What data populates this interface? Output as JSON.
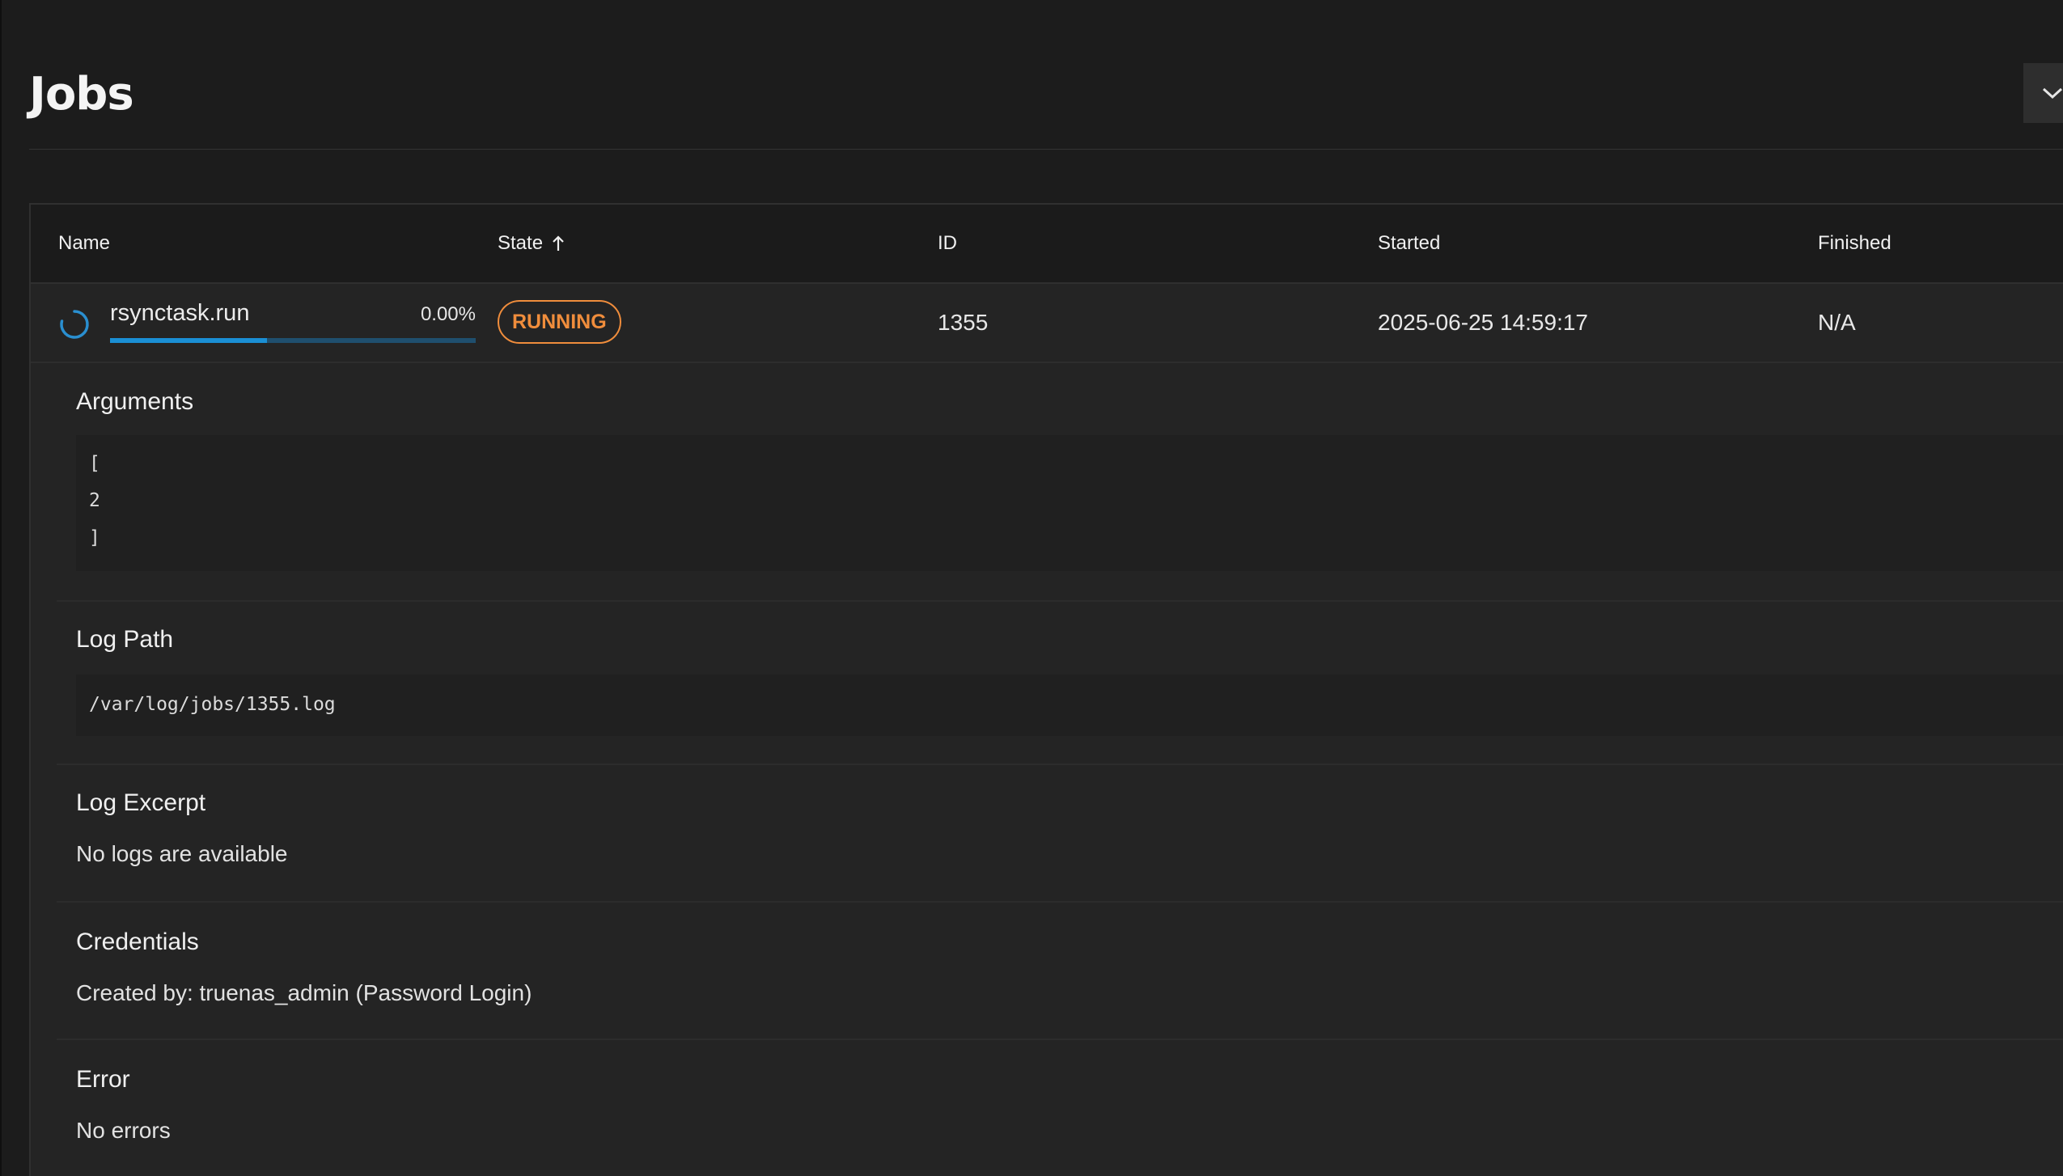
{
  "header": {
    "title": "Jobs",
    "toggle_icon": "chevron-down-icon"
  },
  "table": {
    "columns": [
      "Name",
      "State",
      "ID",
      "Started",
      "Finished"
    ],
    "sort": {
      "column": "State",
      "direction": "ascending",
      "icon": "arrow-up-icon"
    },
    "rows": [
      {
        "name": "rsynctask.run",
        "percent_label": "0.00%",
        "progress_fraction": 0.43,
        "state": "RUNNING",
        "id": "1355",
        "started": "2025-06-25 14:59:17",
        "finished": "N/A",
        "status_icon": "spinner-icon"
      }
    ]
  },
  "details": {
    "arguments": {
      "title": "Arguments",
      "lines": [
        "[",
        "2",
        "]"
      ]
    },
    "log_path": {
      "title": "Log Path",
      "value": "/var/log/jobs/1355.log"
    },
    "log_excerpt": {
      "title": "Log Excerpt",
      "value": "No logs are available"
    },
    "credentials": {
      "title": "Credentials",
      "value": "Created by: truenas_admin (Password Login)"
    },
    "error": {
      "title": "Error",
      "value": "No errors"
    }
  },
  "colors": {
    "background": "#1c1c1c",
    "running_badge": "#f08d3c",
    "progress_fill": "#1a8fd4",
    "progress_track": "#1f4f6e",
    "spinner": "#2a8fd0"
  }
}
